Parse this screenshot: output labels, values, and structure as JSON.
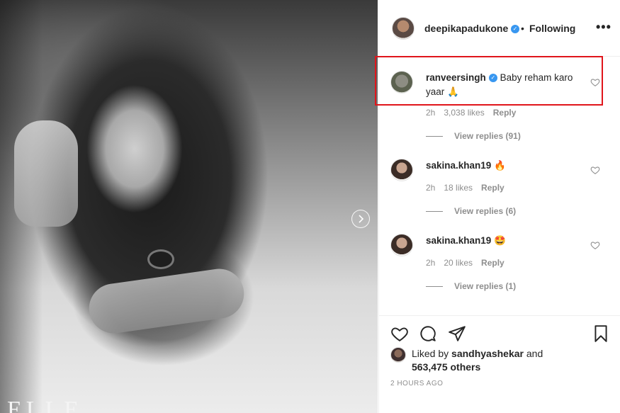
{
  "post": {
    "image_alt": "Black and white photo of a woman lying on sand",
    "logo_text": "ELLE"
  },
  "header": {
    "username": "deepikapadukone",
    "separator": "•",
    "follow_status": "Following",
    "more": "•••"
  },
  "comments": [
    {
      "username": "ranveersingh",
      "verified": true,
      "text": "Baby reham karo yaar 🙏",
      "time": "2h",
      "likes": "3,038 likes",
      "reply_label": "Reply",
      "view_replies": "View replies (91)"
    },
    {
      "username": "sakina.khan19",
      "verified": false,
      "text": "🔥",
      "time": "2h",
      "likes": "18 likes",
      "reply_label": "Reply",
      "view_replies": "View replies (6)"
    },
    {
      "username": "sakina.khan19",
      "verified": false,
      "text": "🤩",
      "time": "2h",
      "likes": "20 likes",
      "reply_label": "Reply",
      "view_replies": "View replies (1)"
    }
  ],
  "liked_by": {
    "prefix": "Liked by",
    "user": "sandhyashekar",
    "and": "and",
    "others": "563,475 others"
  },
  "timestamp": "2 HOURS AGO",
  "icons": {
    "like": "heart-icon",
    "comment": "comment-icon",
    "share": "share-icon",
    "save": "bookmark-icon",
    "next": "chevron-right-icon",
    "verified": "verified-badge-icon"
  },
  "colors": {
    "verified": "#3897f0",
    "highlight": "#e0151b",
    "muted": "#8e8e8e"
  }
}
